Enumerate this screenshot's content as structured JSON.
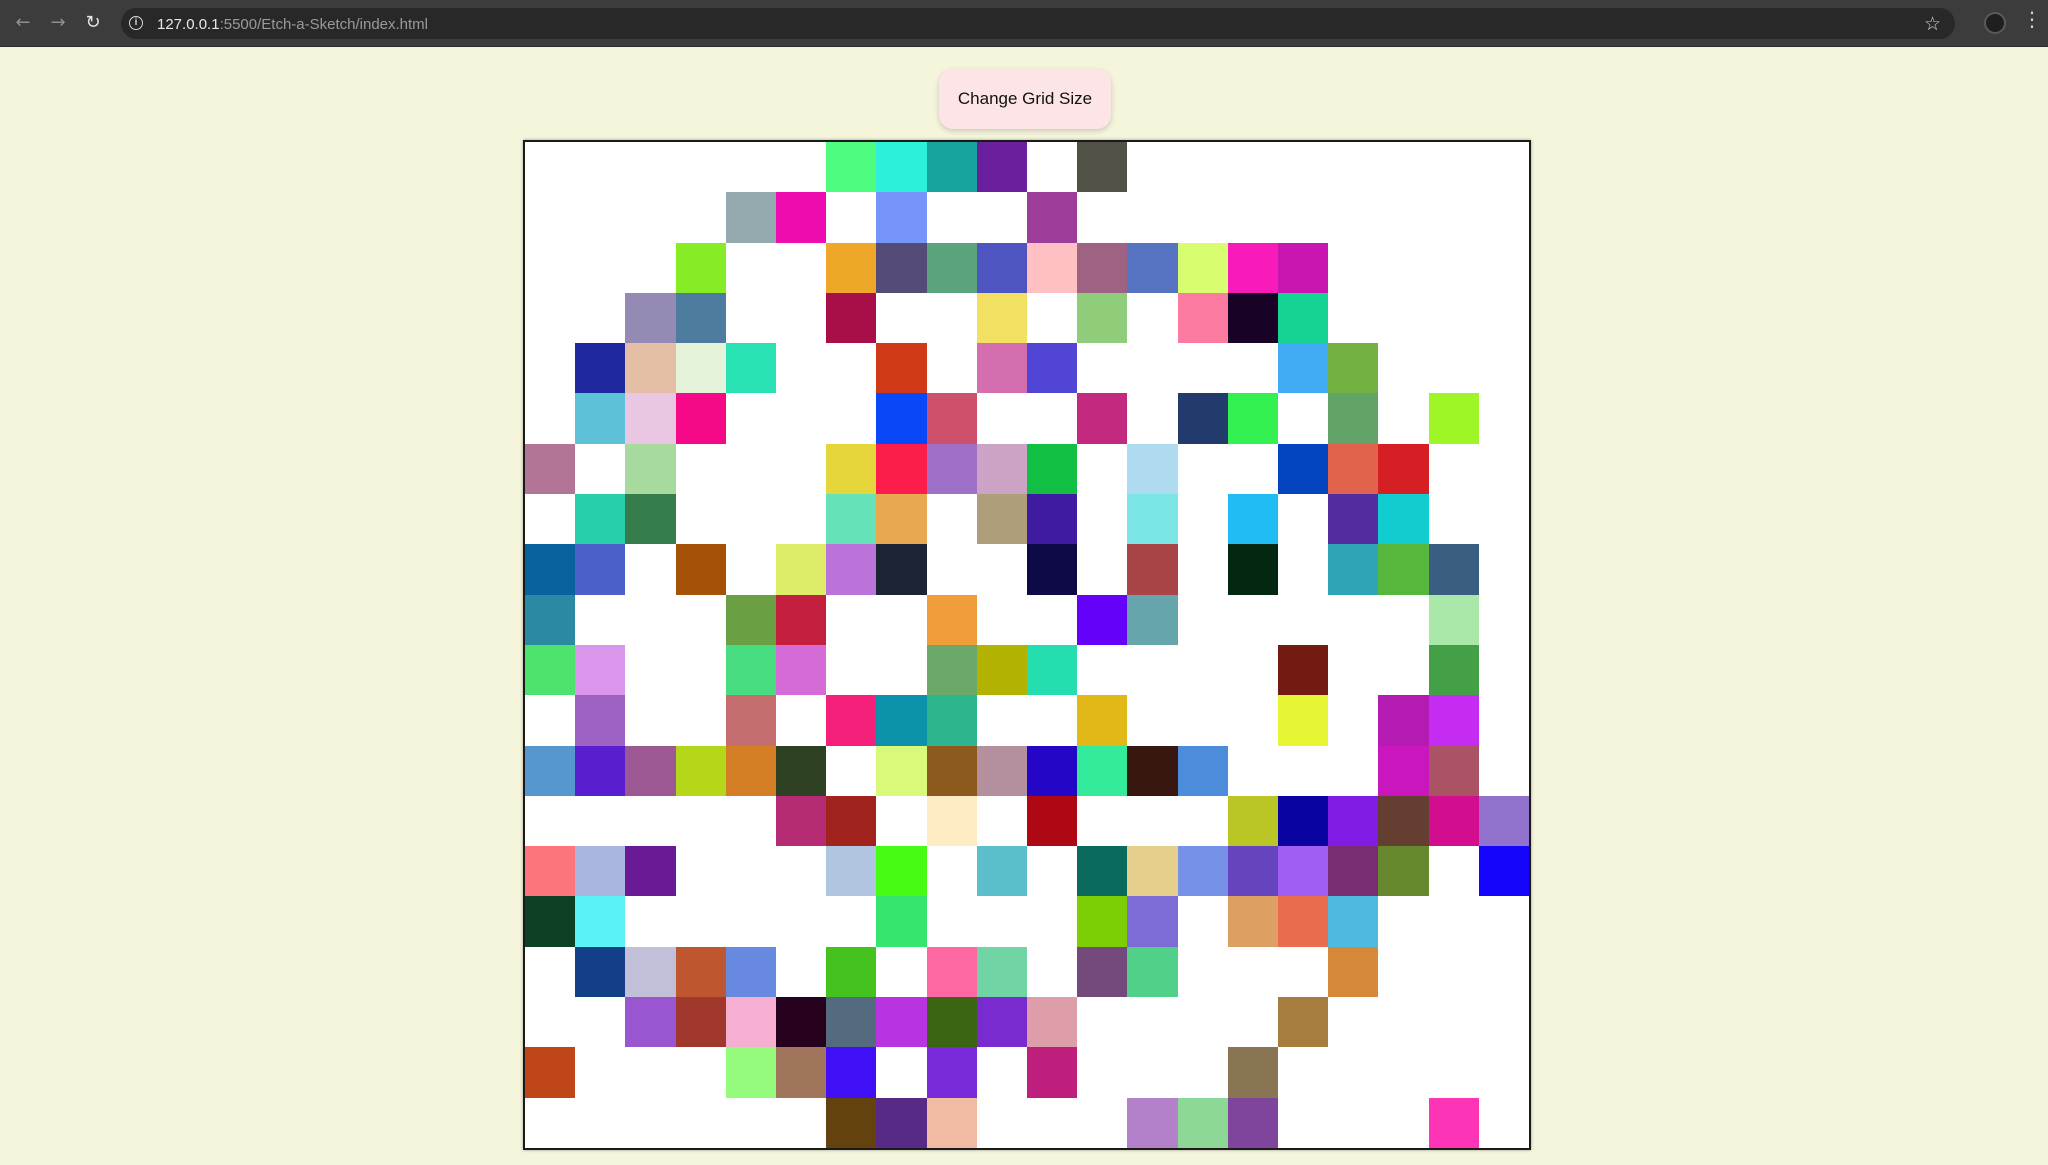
{
  "browser": {
    "url_host": "127.0.0.1",
    "url_rest": ":5500/Etch-a-Sketch/index.html",
    "icons": [
      "back-arrow-icon",
      "forward-arrow-icon",
      "reload-icon",
      "info-icon",
      "star-icon",
      "profile-icon",
      "menu-icon"
    ]
  },
  "page": {
    "button_label": "Change Grid Size",
    "background_color": "#f5f5dc",
    "button_color": "#fde4e7"
  },
  "grid": {
    "size": 20,
    "default_color": "#ffffff",
    "painted_cells": [
      [
        0,
        6,
        "#4efc7f"
      ],
      [
        0,
        7,
        "#2cf0da"
      ],
      [
        0,
        8,
        "#17a39e"
      ],
      [
        0,
        9,
        "#6a1f9c"
      ],
      [
        0,
        11,
        "#515146"
      ],
      [
        1,
        4,
        "#94aaaf"
      ],
      [
        1,
        5,
        "#ee0caf"
      ],
      [
        1,
        7,
        "#7595fb"
      ],
      [
        1,
        10,
        "#9e3c99"
      ],
      [
        2,
        3,
        "#86ec26"
      ],
      [
        2,
        6,
        "#eea728"
      ],
      [
        2,
        7,
        "#544b76"
      ],
      [
        2,
        8,
        "#5ba37c"
      ],
      [
        2,
        9,
        "#4e55c1"
      ],
      [
        2,
        10,
        "#fec0c3"
      ],
      [
        2,
        11,
        "#9e6282"
      ],
      [
        2,
        12,
        "#5674c1"
      ],
      [
        2,
        13,
        "#d9fd70"
      ],
      [
        2,
        14,
        "#f91aba"
      ],
      [
        2,
        15,
        "#c916b0"
      ],
      [
        3,
        2,
        "#958ab3"
      ],
      [
        3,
        3,
        "#4d7c9f"
      ],
      [
        3,
        6,
        "#a80e48"
      ],
      [
        3,
        9,
        "#f1e061"
      ],
      [
        3,
        11,
        "#8fcd7a"
      ],
      [
        3,
        13,
        "#fc7ca1"
      ],
      [
        3,
        14,
        "#180225"
      ],
      [
        3,
        15,
        "#15d493"
      ],
      [
        4,
        1,
        "#1f289d"
      ],
      [
        4,
        2,
        "#e4bfa5"
      ],
      [
        4,
        3,
        "#e4f2da"
      ],
      [
        4,
        4,
        "#28e2b3"
      ],
      [
        4,
        7,
        "#d13a19"
      ],
      [
        4,
        9,
        "#d56eae"
      ],
      [
        4,
        10,
        "#5145d5"
      ],
      [
        4,
        15,
        "#41abf4"
      ],
      [
        4,
        16,
        "#73b042"
      ],
      [
        5,
        1,
        "#5dc2d8"
      ],
      [
        5,
        2,
        "#e9c7e3"
      ],
      [
        5,
        3,
        "#f60986"
      ],
      [
        5,
        7,
        "#0948f6"
      ],
      [
        5,
        8,
        "#cd516b"
      ],
      [
        5,
        11,
        "#c2297f"
      ],
      [
        5,
        13,
        "#223a6c"
      ],
      [
        5,
        14,
        "#33f151"
      ],
      [
        5,
        16,
        "#62a468"
      ],
      [
        5,
        18,
        "#9ff626"
      ],
      [
        6,
        0,
        "#b37595"
      ],
      [
        6,
        2,
        "#a8daa0"
      ],
      [
        6,
        6,
        "#e5d73b"
      ],
      [
        6,
        7,
        "#fc1d4b"
      ],
      [
        6,
        8,
        "#9f70c7"
      ],
      [
        6,
        9,
        "#cca3c5"
      ],
      [
        6,
        10,
        "#11c043"
      ],
      [
        6,
        12,
        "#aedbf0"
      ],
      [
        6,
        15,
        "#0344c0"
      ],
      [
        6,
        16,
        "#e1634b"
      ],
      [
        6,
        17,
        "#d51f24"
      ],
      [
        7,
        1,
        "#27d0a9"
      ],
      [
        7,
        2,
        "#377d4b"
      ],
      [
        7,
        6,
        "#65e2b7"
      ],
      [
        7,
        7,
        "#e8a851"
      ],
      [
        7,
        9,
        "#ae9e7a"
      ],
      [
        7,
        10,
        "#3e1ba1"
      ],
      [
        7,
        12,
        "#7ce6e6"
      ],
      [
        7,
        14,
        "#20bdf4"
      ],
      [
        7,
        16,
        "#532ca0"
      ],
      [
        7,
        17,
        "#12cdd0"
      ],
      [
        8,
        0,
        "#08629e"
      ],
      [
        8,
        1,
        "#4c60cc"
      ],
      [
        8,
        3,
        "#a55108"
      ],
      [
        8,
        5,
        "#dded6a"
      ],
      [
        8,
        6,
        "#bb73dc"
      ],
      [
        8,
        7,
        "#1a2432"
      ],
      [
        8,
        10,
        "#0e0a48"
      ],
      [
        8,
        12,
        "#a94446"
      ],
      [
        8,
        14,
        "#032812"
      ],
      [
        8,
        16,
        "#2ea5b6"
      ],
      [
        8,
        17,
        "#55b83d"
      ],
      [
        8,
        18,
        "#3a5e82"
      ],
      [
        9,
        0,
        "#2a8aa3"
      ],
      [
        9,
        4,
        "#6aa043"
      ],
      [
        9,
        5,
        "#c41f3e"
      ],
      [
        9,
        8,
        "#f09e3b"
      ],
      [
        9,
        11,
        "#6301f9"
      ],
      [
        9,
        12,
        "#66a5ab"
      ],
      [
        9,
        18,
        "#a9e8a8"
      ],
      [
        10,
        0,
        "#4ee36c"
      ],
      [
        10,
        1,
        "#d996eb"
      ],
      [
        10,
        4,
        "#48dc80"
      ],
      [
        10,
        5,
        "#d56bd6"
      ],
      [
        10,
        8,
        "#6da86b"
      ],
      [
        10,
        9,
        "#b2b202"
      ],
      [
        10,
        10,
        "#24deb0"
      ],
      [
        10,
        15,
        "#731a12"
      ],
      [
        10,
        18,
        "#44a046"
      ],
      [
        11,
        1,
        "#9e62c2"
      ],
      [
        11,
        4,
        "#c56e6f"
      ],
      [
        11,
        6,
        "#f5207a"
      ],
      [
        11,
        7,
        "#0c93ab"
      ],
      [
        11,
        8,
        "#2db58d"
      ],
      [
        11,
        11,
        "#e1b818"
      ],
      [
        11,
        15,
        "#e6f534"
      ],
      [
        11,
        17,
        "#b41bb2"
      ],
      [
        11,
        18,
        "#c52cf1"
      ],
      [
        12,
        0,
        "#5697cd"
      ],
      [
        12,
        1,
        "#5a1ed1"
      ],
      [
        12,
        2,
        "#9b5893"
      ],
      [
        12,
        3,
        "#b5d71a"
      ],
      [
        12,
        4,
        "#d47f25"
      ],
      [
        12,
        5,
        "#2f4123"
      ],
      [
        12,
        7,
        "#d8f97a"
      ],
      [
        12,
        8,
        "#8c5a1d"
      ],
      [
        12,
        9,
        "#b48f9e"
      ],
      [
        12,
        10,
        "#2306c6"
      ],
      [
        12,
        11,
        "#34eb9b"
      ],
      [
        12,
        12,
        "#371710"
      ],
      [
        12,
        13,
        "#4d8bdb"
      ],
      [
        12,
        17,
        "#c917bd"
      ],
      [
        12,
        18,
        "#a95364"
      ],
      [
        13,
        5,
        "#b52c74"
      ],
      [
        13,
        6,
        "#a0231d"
      ],
      [
        13,
        8,
        "#feedc2"
      ],
      [
        13,
        10,
        "#ad0813"
      ],
      [
        13,
        14,
        "#b9c626"
      ],
      [
        13,
        15,
        "#0b03a1"
      ],
      [
        13,
        16,
        "#821be3"
      ],
      [
        13,
        17,
        "#633e31"
      ],
      [
        13,
        18,
        "#d30e8e"
      ],
      [
        13,
        19,
        "#9173ce"
      ],
      [
        14,
        0,
        "#fd747d"
      ],
      [
        14,
        1,
        "#a8b6e1"
      ],
      [
        14,
        2,
        "#6b1a95"
      ],
      [
        14,
        6,
        "#b0c5df"
      ],
      [
        14,
        7,
        "#45fc12"
      ],
      [
        14,
        9,
        "#5bbfcb"
      ],
      [
        14,
        11,
        "#0a6b5d"
      ],
      [
        14,
        12,
        "#e5cf8d"
      ],
      [
        14,
        13,
        "#7591e8"
      ],
      [
        14,
        14,
        "#6644be"
      ],
      [
        14,
        15,
        "#9f5ff3"
      ],
      [
        14,
        16,
        "#782c72"
      ],
      [
        14,
        17,
        "#67892d"
      ],
      [
        14,
        19,
        "#1505fb"
      ],
      [
        15,
        0,
        "#0c4124"
      ],
      [
        15,
        1,
        "#5cf0f7"
      ],
      [
        15,
        7,
        "#36e56e"
      ],
      [
        15,
        11,
        "#7dcf05"
      ],
      [
        15,
        12,
        "#7d6bd6"
      ],
      [
        15,
        14,
        "#dd9f62"
      ],
      [
        15,
        15,
        "#e96c4f"
      ],
      [
        15,
        16,
        "#4fbae0"
      ],
      [
        16,
        1,
        "#123f87"
      ],
      [
        16,
        2,
        "#c1c0d8"
      ],
      [
        16,
        3,
        "#be572f"
      ],
      [
        16,
        4,
        "#6889e0"
      ],
      [
        16,
        6,
        "#44c31e"
      ],
      [
        16,
        8,
        "#fd68a3"
      ],
      [
        16,
        9,
        "#71d4a5"
      ],
      [
        16,
        11,
        "#744a7c"
      ],
      [
        16,
        12,
        "#50d089"
      ],
      [
        16,
        16,
        "#d5883a"
      ],
      [
        17,
        2,
        "#9a56d1"
      ],
      [
        17,
        3,
        "#a0382d"
      ],
      [
        17,
        4,
        "#f6aed1"
      ],
      [
        17,
        5,
        "#26021e"
      ],
      [
        17,
        6,
        "#536a7f"
      ],
      [
        17,
        7,
        "#b934e1"
      ],
      [
        17,
        8,
        "#3b6513"
      ],
      [
        17,
        9,
        "#7a2bcf"
      ],
      [
        17,
        10,
        "#dd9ea9"
      ],
      [
        17,
        15,
        "#a67c3f"
      ],
      [
        18,
        0,
        "#be4618"
      ],
      [
        18,
        4,
        "#94fb7c"
      ],
      [
        18,
        5,
        "#a1745c"
      ],
      [
        18,
        6,
        "#4110f7"
      ],
      [
        18,
        8,
        "#782ad9"
      ],
      [
        18,
        10,
        "#bf1f7c"
      ],
      [
        18,
        14,
        "#897553"
      ],
      [
        19,
        6,
        "#644210"
      ],
      [
        19,
        7,
        "#562a85"
      ],
      [
        19,
        8,
        "#f1bba3"
      ],
      [
        19,
        12,
        "#b381ca"
      ],
      [
        19,
        13,
        "#8dd797"
      ],
      [
        19,
        14,
        "#7f449c"
      ],
      [
        19,
        18,
        "#fe34b7"
      ]
    ]
  }
}
